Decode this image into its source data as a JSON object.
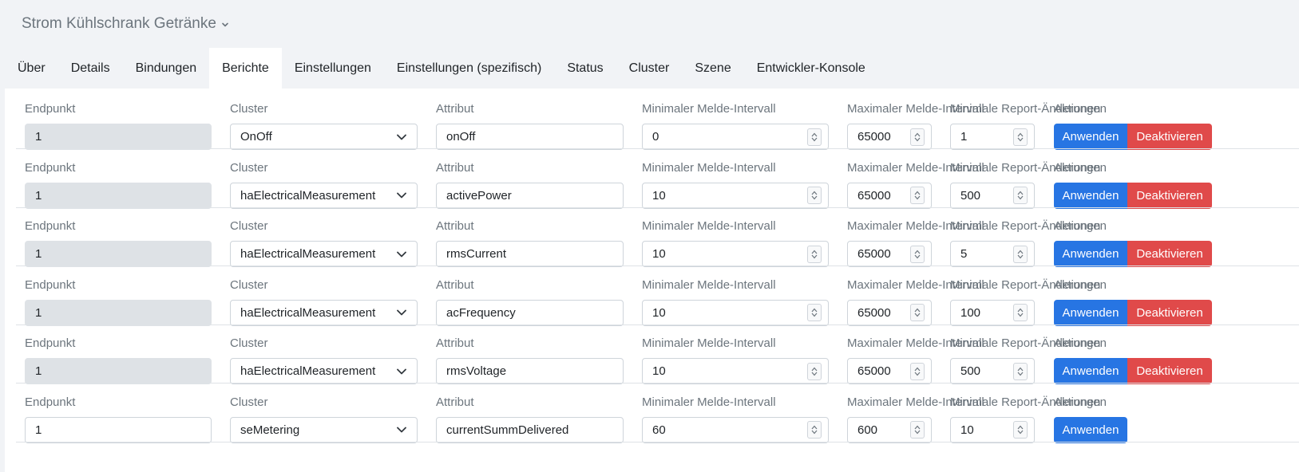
{
  "device": {
    "title": "Strom Kühlschrank Getränke"
  },
  "tabs": [
    {
      "label": "Über"
    },
    {
      "label": "Details"
    },
    {
      "label": "Bindungen"
    },
    {
      "label": "Berichte",
      "active": true
    },
    {
      "label": "Einstellungen"
    },
    {
      "label": "Einstellungen (spezifisch)"
    },
    {
      "label": "Status"
    },
    {
      "label": "Cluster"
    },
    {
      "label": "Szene"
    },
    {
      "label": "Entwickler-Konsole"
    }
  ],
  "labels": {
    "endpoint": "Endpunkt",
    "cluster": "Cluster",
    "attribute": "Attribut",
    "min_interval": "Minimaler Melde-Intervall",
    "max_interval": "Maximaler Melde-Intervall",
    "min_change": "Minimale Report-Änderungen",
    "actions": "Aktionen"
  },
  "buttons": {
    "apply": "Anwenden",
    "deactivate": "Deaktivieren"
  },
  "reports": [
    {
      "endpoint": "1",
      "endpoint_disabled": true,
      "cluster": "OnOff",
      "attribute": "onOff",
      "min_interval": "0",
      "max_interval": "65000",
      "min_change": "1",
      "active": true
    },
    {
      "endpoint": "1",
      "endpoint_disabled": true,
      "cluster": "haElectricalMeasurement",
      "attribute": "activePower",
      "min_interval": "10",
      "max_interval": "65000",
      "min_change": "500",
      "active": true
    },
    {
      "endpoint": "1",
      "endpoint_disabled": true,
      "cluster": "haElectricalMeasurement",
      "attribute": "rmsCurrent",
      "min_interval": "10",
      "max_interval": "65000",
      "min_change": "5",
      "active": true
    },
    {
      "endpoint": "1",
      "endpoint_disabled": true,
      "cluster": "haElectricalMeasurement",
      "attribute": "acFrequency",
      "min_interval": "10",
      "max_interval": "65000",
      "min_change": "100",
      "active": true
    },
    {
      "endpoint": "1",
      "endpoint_disabled": true,
      "cluster": "haElectricalMeasurement",
      "attribute": "rmsVoltage",
      "min_interval": "10",
      "max_interval": "65000",
      "min_change": "500",
      "active": true
    },
    {
      "endpoint": "1",
      "endpoint_disabled": false,
      "cluster": "seMetering",
      "attribute": "currentSummDelivered",
      "min_interval": "60",
      "max_interval": "600",
      "min_change": "10",
      "active": false
    }
  ]
}
